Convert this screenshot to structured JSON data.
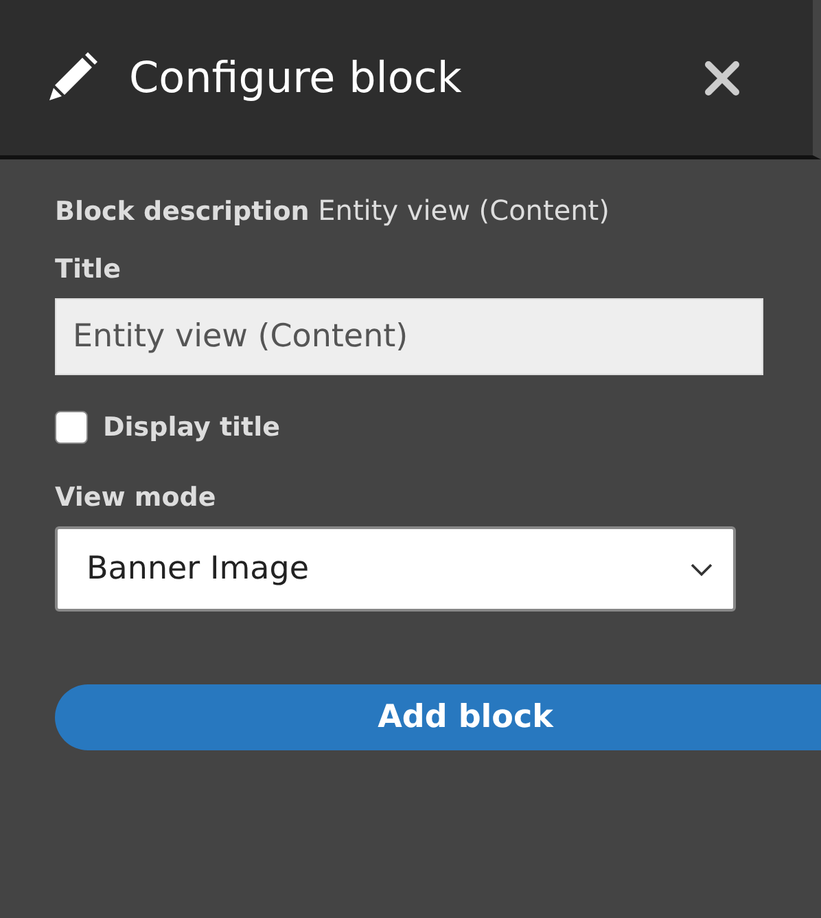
{
  "dialog": {
    "title": "Configure block"
  },
  "block_description": {
    "label": "Block description",
    "value": "Entity view (Content)"
  },
  "title_field": {
    "label": "Title",
    "value": "Entity view (Content)",
    "disabled": true
  },
  "display_title": {
    "label": "Display title",
    "checked": false
  },
  "view_mode": {
    "label": "View mode",
    "value": "Banner Image"
  },
  "submit": {
    "label": "Add block"
  }
}
